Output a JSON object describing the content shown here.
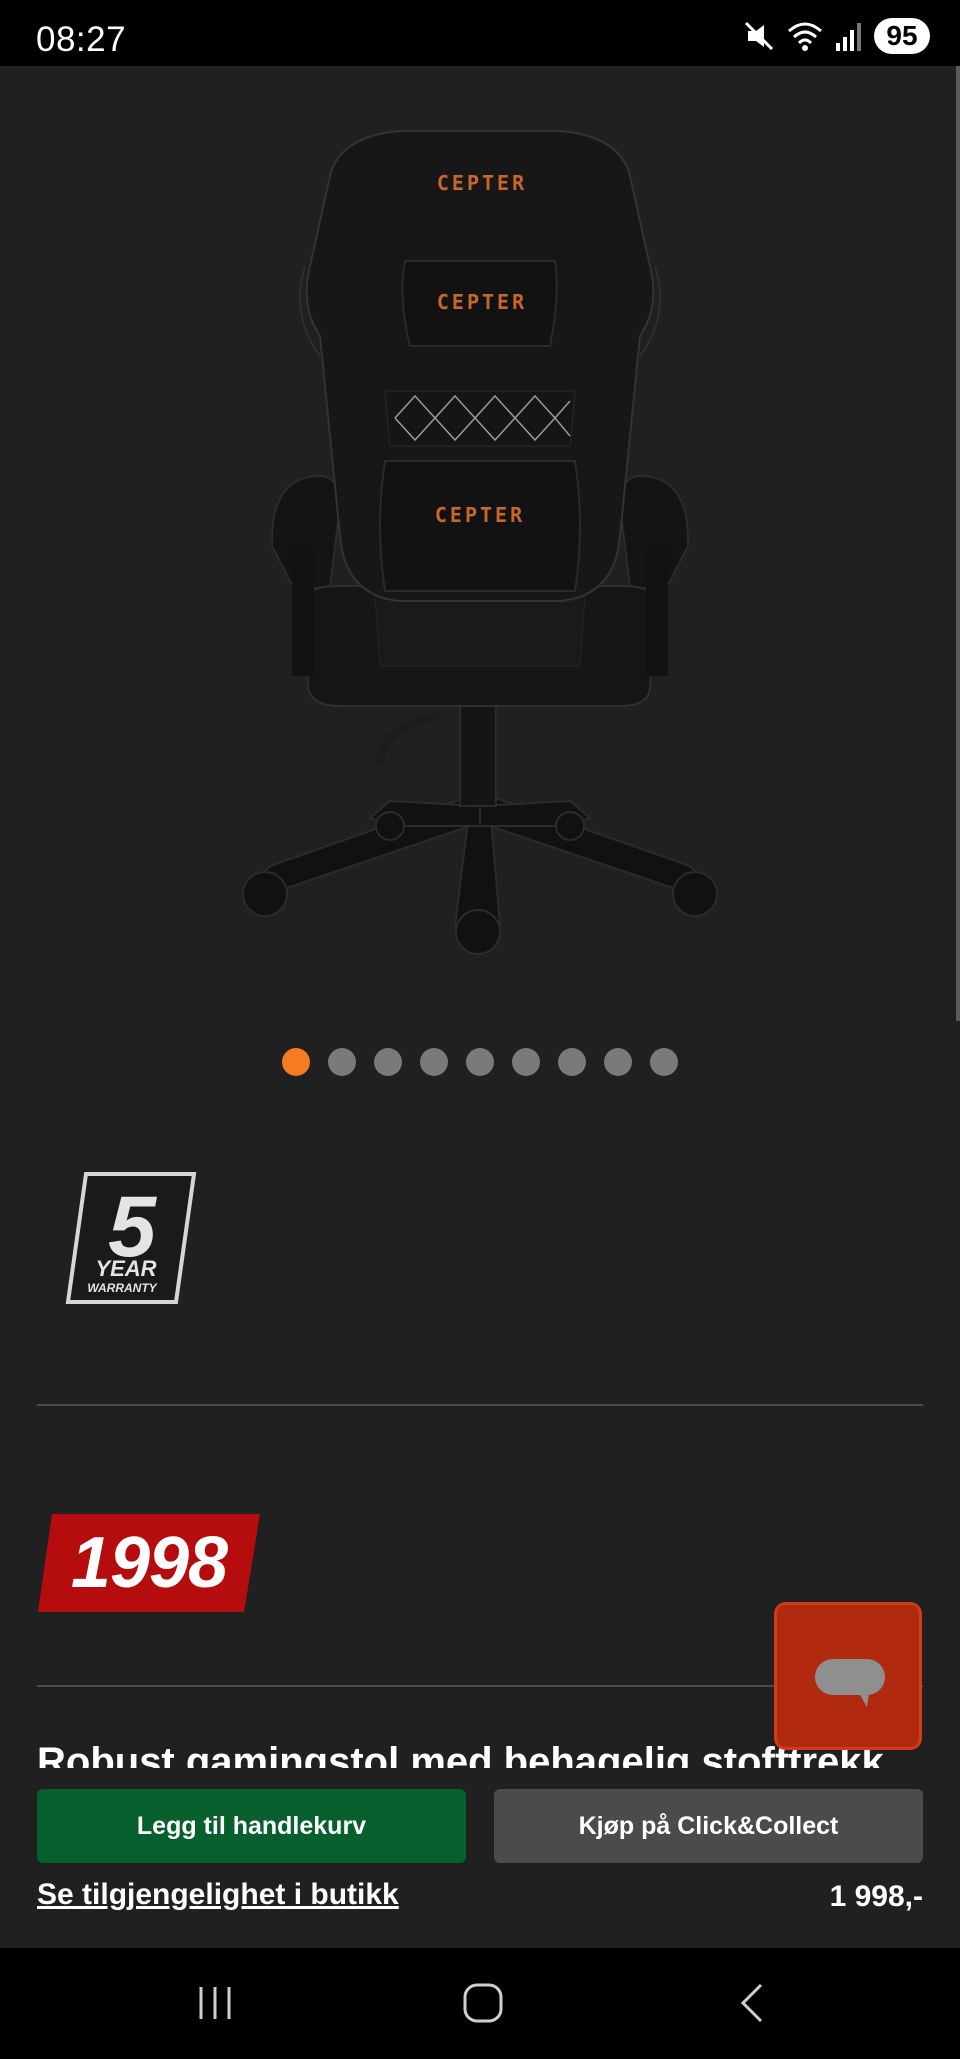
{
  "status": {
    "time": "08:27",
    "battery": "95",
    "icons": [
      "mute-icon",
      "wifi-icon",
      "signal-icon"
    ]
  },
  "product": {
    "image": {
      "brand_mark": "CEPTER",
      "description_icon": "gaming-chair-image"
    },
    "carousel": {
      "count": 9,
      "active_index": 0
    },
    "warranty": {
      "number": "5",
      "line1": "YEAR",
      "line2": "WARRANTY"
    },
    "price_badge": "1998",
    "title": "Robust gamingstol med behagelig stofftrekk"
  },
  "actions": {
    "add_to_cart": "Legg til handlekurv",
    "click_collect": "Kjøp på Click&Collect",
    "availability_link": "Se tilgjengelighet i butikk",
    "price": "1 998,-"
  },
  "chat": {
    "icon": "chat-bubble-icon"
  },
  "nav": {
    "icons": [
      "recent-apps-icon",
      "home-icon",
      "back-icon"
    ]
  },
  "colors": {
    "background": "#202020",
    "accent_orange": "#f57c1f",
    "cart_green": "#075f2d",
    "price_red": "#b50d0d",
    "chat_red": "#b12a0f"
  }
}
